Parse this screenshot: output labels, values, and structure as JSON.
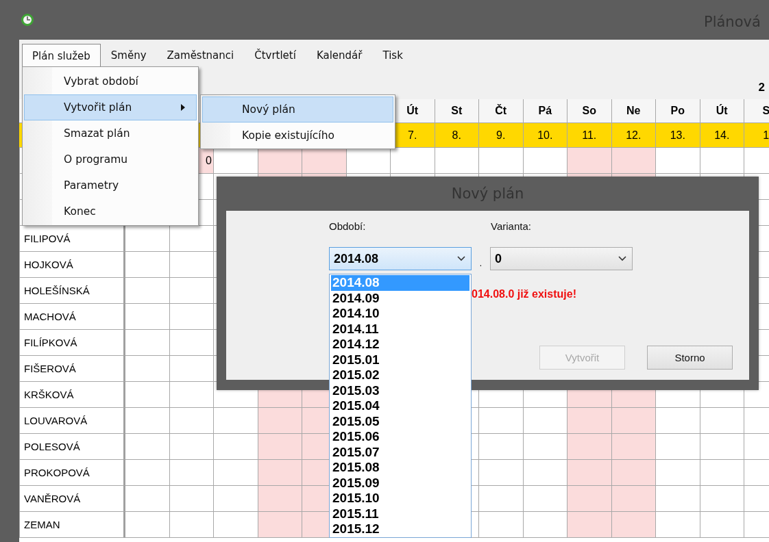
{
  "window": {
    "title": "Plánová"
  },
  "menu_bar": [
    {
      "label": "Plán služeb",
      "selected": true
    },
    {
      "label": "Směny",
      "selected": false
    },
    {
      "label": "Zaměstnanci",
      "selected": false
    },
    {
      "label": "Čtvrtletí",
      "selected": false
    },
    {
      "label": "Kalendář",
      "selected": false
    },
    {
      "label": "Tisk",
      "selected": false
    }
  ],
  "toolbar": {
    "year": "2"
  },
  "grid": {
    "columns": [
      {
        "weekend": false
      },
      {
        "weekend": false
      },
      {
        "weekend": false
      },
      {
        "weekend": true
      },
      {
        "weekend": true
      },
      {
        "weekend": false
      },
      {
        "day": "Út",
        "date": "7.",
        "weekend": false
      },
      {
        "day": "St",
        "date": "8.",
        "weekend": false
      },
      {
        "day": "Čt",
        "date": "9.",
        "weekend": false
      },
      {
        "day": "Pá",
        "date": "10.",
        "weekend": false
      },
      {
        "day": "So",
        "date": "11.",
        "weekend": true
      },
      {
        "day": "Ne",
        "date": "12.",
        "weekend": true
      },
      {
        "day": "Po",
        "date": "13.",
        "weekend": false
      },
      {
        "day": "Út",
        "date": "14.",
        "weekend": false
      },
      {
        "day": "S",
        "date": "1",
        "weekend": false
      }
    ],
    "rows": [
      {
        "note": "0"
      },
      {},
      {},
      {
        "name": "FILIPOVÁ"
      },
      {
        "name": "HOJKOVÁ"
      },
      {
        "name": "HOLEŠÍNSKÁ"
      },
      {
        "name": "MACHOVÁ"
      },
      {
        "name": "FILÍPKOVÁ"
      },
      {
        "name": "FIŠEROVÁ"
      },
      {
        "name": "KRŠKOVÁ"
      },
      {
        "name": "LOUVAROVÁ"
      },
      {
        "name": "POLESOVÁ"
      },
      {
        "name": "PROKOPOVÁ"
      },
      {
        "name": "VANĚROVÁ"
      },
      {
        "name": "ZEMAN"
      }
    ]
  },
  "menu": {
    "items": [
      {
        "label": "Vybrat období",
        "selected": false,
        "submenu": false
      },
      {
        "label": "Vytvořit plán",
        "selected": true,
        "submenu": true
      },
      {
        "label": "Smazat plán",
        "selected": false,
        "submenu": false
      },
      {
        "label": "O programu",
        "selected": false,
        "submenu": false
      },
      {
        "label": "Parametry",
        "selected": false,
        "submenu": false
      },
      {
        "label": "Konec",
        "selected": false,
        "submenu": false
      }
    ],
    "submenu": [
      {
        "label": "Nový plán",
        "selected": true
      },
      {
        "label": "Kopie existujícího",
        "selected": false
      }
    ]
  },
  "dialog": {
    "title": "Nový plán",
    "period": {
      "label": "Období:",
      "value": "2014.08",
      "open": true,
      "options": [
        {
          "label": "2014.08",
          "selected": true
        },
        {
          "label": "2014.09",
          "selected": false
        },
        {
          "label": "2014.10",
          "selected": false
        },
        {
          "label": "2014.11",
          "selected": false
        },
        {
          "label": "2014.12",
          "selected": false
        },
        {
          "label": "2015.01",
          "selected": false
        },
        {
          "label": "2015.02",
          "selected": false
        },
        {
          "label": "2015.03",
          "selected": false
        },
        {
          "label": "2015.04",
          "selected": false
        },
        {
          "label": "2015.05",
          "selected": false
        },
        {
          "label": "2015.06",
          "selected": false
        },
        {
          "label": "2015.07",
          "selected": false
        },
        {
          "label": "2015.08",
          "selected": false
        },
        {
          "label": "2015.09",
          "selected": false
        },
        {
          "label": "2015.10",
          "selected": false
        },
        {
          "label": "2015.11",
          "selected": false
        },
        {
          "label": "2015.12",
          "selected": false
        }
      ]
    },
    "separator": ".",
    "variant": {
      "label": "Varianta:",
      "value": "0"
    },
    "error": "014.08.0 již existuje!",
    "buttons": [
      {
        "label": "Vytvořit",
        "disabled": true
      },
      {
        "label": "Storno",
        "disabled": false
      }
    ]
  }
}
